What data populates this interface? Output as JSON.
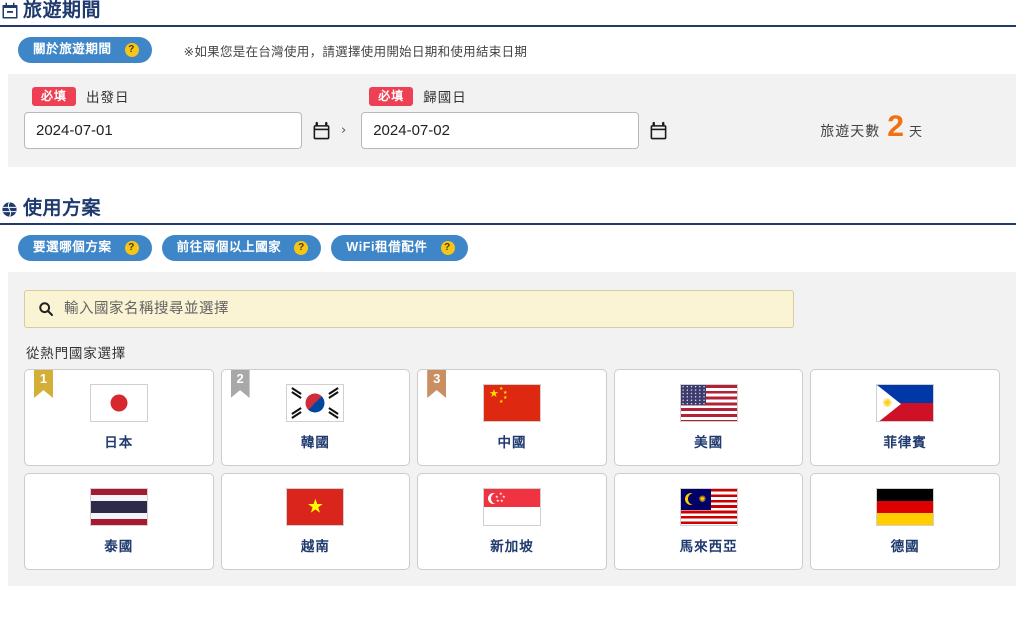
{
  "section_period": {
    "icon": "calendar-minus-icon",
    "title": "旅遊期間",
    "help_button": {
      "label": "關於旅遊期間",
      "help_glyph": "?"
    },
    "notice": "※如果您是在台灣使用，請選擇使用開始日期和使用結束日期",
    "departure": {
      "required_badge": "必填",
      "label": "出發日",
      "value": "2024-07-01",
      "calendar_icon": "calendar-icon"
    },
    "separator": "›",
    "return": {
      "required_badge": "必填",
      "label": "歸國日",
      "value": "2024-07-02",
      "calendar_icon": "calendar-icon"
    },
    "days": {
      "label": "旅遊天數",
      "count": "2",
      "unit": "天"
    }
  },
  "section_plan": {
    "icon": "globe-icon",
    "title": "使用方案",
    "help_buttons": [
      {
        "label": "要選哪個方案",
        "help_glyph": "?"
      },
      {
        "label": "前往兩個以上國家",
        "help_glyph": "?"
      },
      {
        "label": "WiFi租借配件",
        "help_glyph": "?"
      }
    ],
    "search": {
      "icon": "search-icon",
      "placeholder": "輸入國家名稱搜尋並選擇",
      "value": ""
    },
    "popular_label": "從熱門國家選擇",
    "countries": [
      {
        "name": "日本",
        "flag": "jp",
        "rank": "1",
        "rank_color": "#d4af37"
      },
      {
        "name": "韓國",
        "flag": "kr",
        "rank": "2",
        "rank_color": "#a8a8a8"
      },
      {
        "name": "中國",
        "flag": "cn",
        "rank": "3",
        "rank_color": "#c98f63"
      },
      {
        "name": "美國",
        "flag": "us",
        "rank": "",
        "rank_color": ""
      },
      {
        "name": "菲律賓",
        "flag": "ph",
        "rank": "",
        "rank_color": ""
      },
      {
        "name": "泰國",
        "flag": "th",
        "rank": "",
        "rank_color": ""
      },
      {
        "name": "越南",
        "flag": "vn",
        "rank": "",
        "rank_color": ""
      },
      {
        "name": "新加坡",
        "flag": "sg",
        "rank": "",
        "rank_color": ""
      },
      {
        "name": "馬來西亞",
        "flag": "my",
        "rank": "",
        "rank_color": ""
      },
      {
        "name": "德國",
        "flag": "de",
        "rank": "",
        "rank_color": ""
      }
    ]
  },
  "colors": {
    "heading": "#1f3a6e",
    "pill_blue": "#3f86c8",
    "help_yellow": "#f5c518",
    "required_red": "#ee4055",
    "days_orange": "#f2700f",
    "panel_grey": "#f2f2f2",
    "search_cream": "#faf3d4"
  }
}
